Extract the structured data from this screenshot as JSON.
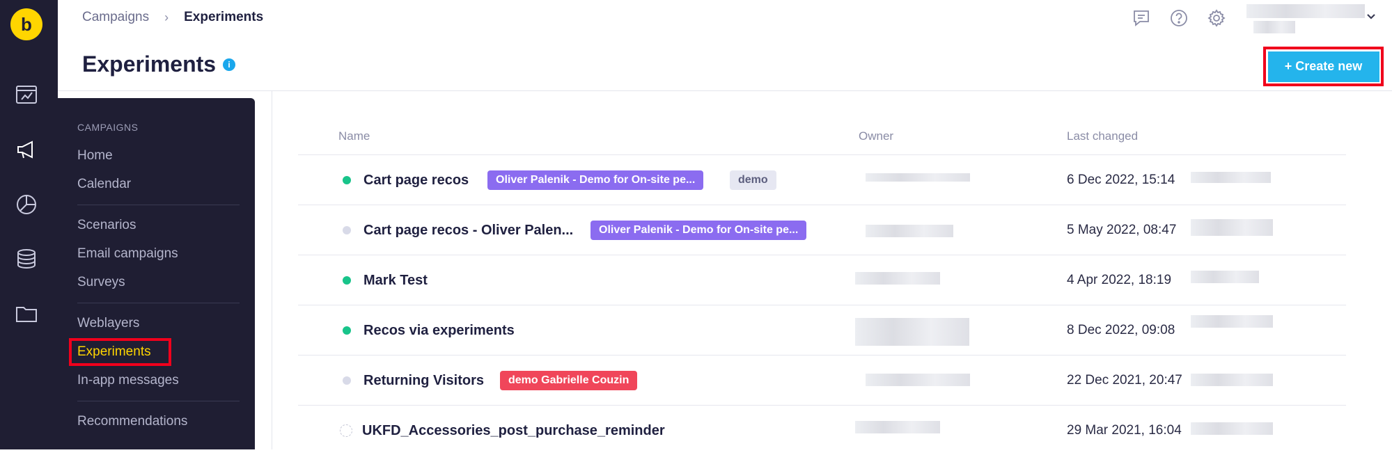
{
  "app": {
    "logo_glyph": "b"
  },
  "rail": {
    "icons": [
      "dashboard-icon",
      "megaphone-icon",
      "pie-chart-icon",
      "database-icon",
      "folder-icon"
    ]
  },
  "breadcrumb": {
    "parent": "Campaigns",
    "separator": "›",
    "current": "Experiments"
  },
  "header": {
    "title": "Experiments",
    "info_glyph": "i",
    "icons": [
      "chat-icon",
      "help-icon",
      "gear-icon"
    ],
    "create_button": "+ Create new"
  },
  "menu": {
    "heading": "CAMPAIGNS",
    "groups": [
      [
        "Home",
        "Calendar"
      ],
      [
        "Scenarios",
        "Email campaigns",
        "Surveys"
      ],
      [
        "Weblayers",
        "Experiments",
        "In-app messages"
      ],
      [
        "Recommendations"
      ]
    ],
    "active_item": "Experiments"
  },
  "table": {
    "columns": {
      "name": "Name",
      "owner": "Owner",
      "last_changed": "Last changed"
    },
    "rows": [
      {
        "status": "active",
        "name": "Cart page recos",
        "tags": [
          {
            "label": "Oliver Palenik - Demo for On-site pe...",
            "color": "purple"
          },
          {
            "label": "demo",
            "color": "grey"
          }
        ],
        "last_changed": "6 Dec 2022, 15:14"
      },
      {
        "status": "inactive",
        "name": "Cart page recos - Oliver Palen...",
        "tags": [
          {
            "label": "Oliver Palenik - Demo for On-site pe...",
            "color": "purple"
          }
        ],
        "last_changed": "5 May 2022, 08:47"
      },
      {
        "status": "active",
        "name": "Mark Test",
        "tags": [],
        "last_changed": "4 Apr 2022, 18:19"
      },
      {
        "status": "active",
        "name": "Recos via experiments",
        "tags": [],
        "last_changed": "8 Dec 2022, 09:08"
      },
      {
        "status": "inactive",
        "name": "Returning Visitors",
        "tags": [
          {
            "label": "demo Gabrielle Couzin",
            "color": "red"
          }
        ],
        "last_changed": "22 Dec 2021, 20:47"
      },
      {
        "status": "draft",
        "name": "UKFD_Accessories_post_purchase_reminder",
        "tags": [],
        "last_changed": "29 Mar 2021, 16:04"
      }
    ]
  },
  "colors": {
    "sidebar_bg": "#1f1e33",
    "brand_yellow": "#ffd500",
    "create_button": "#24b4ec",
    "highlight_red": "#f0001c",
    "status_active": "#18c48a",
    "tag_purple": "#8b6cf0",
    "tag_red": "#f0465a"
  }
}
